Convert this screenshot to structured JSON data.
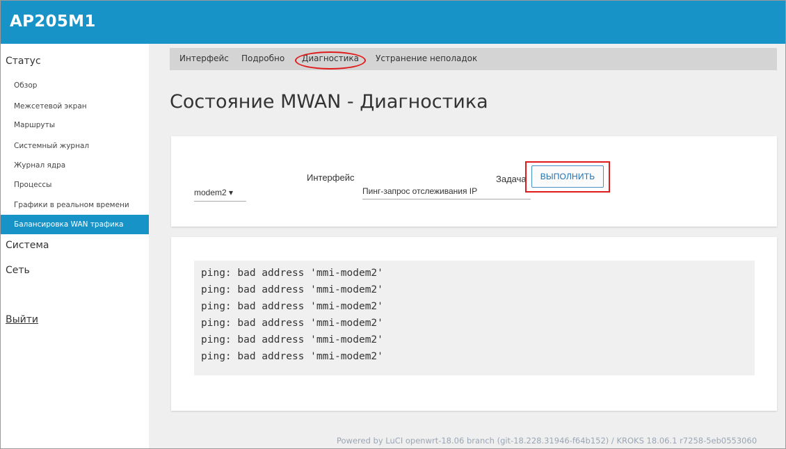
{
  "header": {
    "brand": "AP205M1"
  },
  "sidebar": {
    "status_group": "Статус",
    "status_items": [
      {
        "label": "Обзор"
      },
      {
        "label": "Межсетевой экран"
      },
      {
        "label": "Маршруты"
      },
      {
        "label": "Системный журнал"
      },
      {
        "label": "Журнал ядра"
      },
      {
        "label": "Процессы"
      },
      {
        "label": "Графики в реальном времени"
      },
      {
        "label": "Балансировка WAN трафика",
        "active": true
      }
    ],
    "system_group": "Система",
    "network_group": "Сеть",
    "logout": "Выйти"
  },
  "tabs": [
    {
      "label": "Интерфейс"
    },
    {
      "label": "Подробно"
    },
    {
      "label": "Диагностика",
      "active": true
    },
    {
      "label": "Устранение неполадок"
    }
  ],
  "page_title": "Состояние MWAN - Диагностика",
  "diagnostics": {
    "interface_label": "Интерфейс",
    "interface_value": "modem2 ▾",
    "task_label": "Задача",
    "task_value": "Пинг-запрос отслеживания IP",
    "run_button": "ВЫПОЛНИТЬ"
  },
  "output": {
    "lines": [
      "ping: bad address 'mmi-modem2'",
      "ping: bad address 'mmi-modem2'",
      "ping: bad address 'mmi-modem2'",
      "ping: bad address 'mmi-modem2'",
      "ping: bad address 'mmi-modem2'",
      "ping: bad address 'mmi-modem2'"
    ]
  },
  "footer": "Powered by LuCI openwrt-18.06 branch (git-18.228.31946-f64b152) / KROKS 18.06.1 r7258-5eb0553060",
  "colors": {
    "accent": "#1793c8",
    "highlight": "#e01a1a",
    "button_text": "#1f6fb0"
  }
}
